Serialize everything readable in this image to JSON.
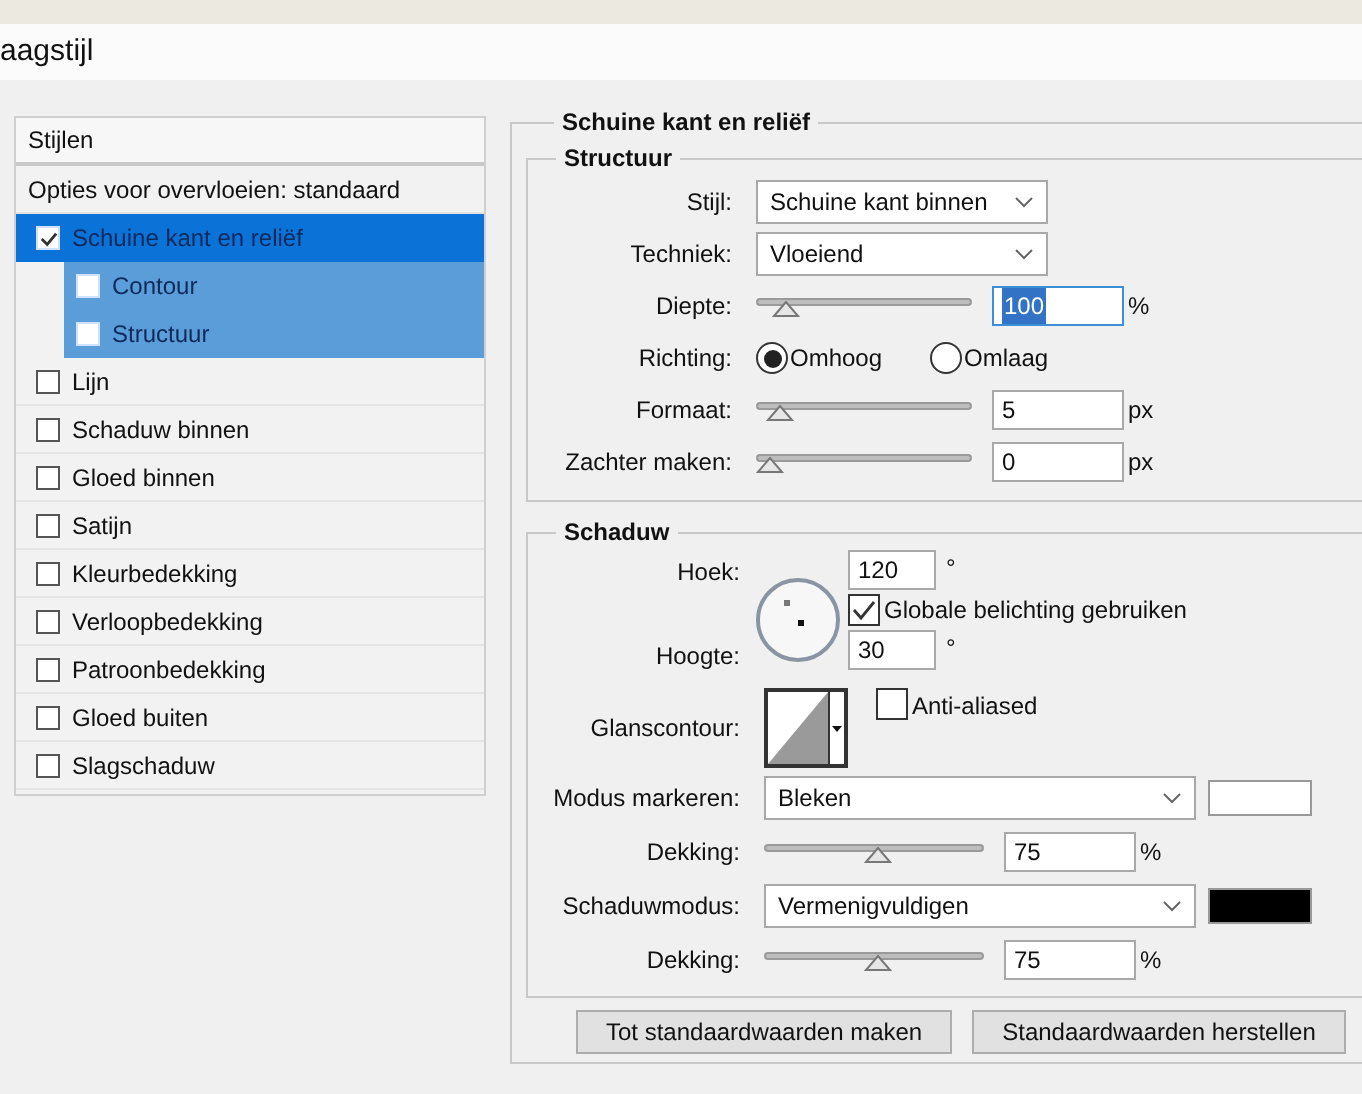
{
  "window": {
    "title": "aagstijl"
  },
  "sidebar": {
    "header": "Stijlen",
    "blending_options": "Opties voor overvloeien: standaard",
    "items": [
      {
        "label": "Schuine kant en reliëf",
        "checked": true,
        "selected": true,
        "children": [
          {
            "label": "Contour",
            "checked": false,
            "selected": false
          },
          {
            "label": "Structuur",
            "checked": false,
            "selected": false
          }
        ]
      },
      {
        "label": "Lijn",
        "checked": false,
        "selected": false
      },
      {
        "label": "Schaduw binnen",
        "checked": false,
        "selected": false
      },
      {
        "label": "Gloed binnen",
        "checked": false,
        "selected": false
      },
      {
        "label": "Satijn",
        "checked": false,
        "selected": false
      },
      {
        "label": "Kleurbedekking",
        "checked": false,
        "selected": false
      },
      {
        "label": "Verloopbedekking",
        "checked": false,
        "selected": false
      },
      {
        "label": "Patroonbedekking",
        "checked": false,
        "selected": false
      },
      {
        "label": "Gloed buiten",
        "checked": false,
        "selected": false
      },
      {
        "label": "Slagschaduw",
        "checked": false,
        "selected": false
      }
    ]
  },
  "bevel_emboss": {
    "title": "Schuine kant en reliëf",
    "structure": {
      "title": "Structuur",
      "rows": [
        {
          "kind": "select",
          "label": "Stijl:",
          "value": "Schuine kant binnen"
        },
        {
          "kind": "select",
          "label": "Techniek:",
          "value": "Vloeiend"
        },
        {
          "kind": "slider",
          "label": "Diepte:",
          "level": 0.08,
          "value": "100",
          "unit": "%",
          "value_selected": true
        },
        {
          "kind": "radio",
          "label": "Richting:",
          "options": [
            {
              "label": "Omhoog",
              "selected": true
            },
            {
              "label": "Omlaag",
              "selected": false
            }
          ]
        },
        {
          "kind": "slider",
          "label": "Formaat:",
          "level": 0.05,
          "value": "5",
          "unit": "px",
          "value_selected": false
        },
        {
          "kind": "slider",
          "label": "Zachter maken:",
          "level": 0.0,
          "value": "0",
          "unit": "px",
          "value_selected": false
        }
      ]
    },
    "shading": {
      "title": "Schaduw",
      "angle_label": "Hoek:",
      "angle": "120",
      "angle_unit": "°",
      "global_light": {
        "label": "Globale belichting gebruiken",
        "checked": true
      },
      "altitude_label": "Hoogte:",
      "altitude": "30",
      "altitude_unit": "°",
      "gloss_contour_label": "Glanscontour:",
      "anti_aliased": {
        "label": "Anti-aliased",
        "checked": false
      },
      "rows": [
        {
          "kind": "select",
          "label": "Modus markeren:",
          "value": "Bleken",
          "color": "#ffffff"
        },
        {
          "kind": "slider",
          "label": "Dekking:",
          "level": 0.52,
          "value": "75",
          "unit": "%",
          "value_selected": false
        },
        {
          "kind": "select",
          "label": "Schaduwmodus:",
          "value": "Vermenigvuldigen",
          "color": "#000000"
        },
        {
          "kind": "slider",
          "label": "Dekking:",
          "level": 0.52,
          "value": "75",
          "unit": "%",
          "value_selected": false
        }
      ]
    }
  },
  "buttons": [
    "Tot standaardwaarden maken",
    "Standaardwaarden herstellen"
  ]
}
